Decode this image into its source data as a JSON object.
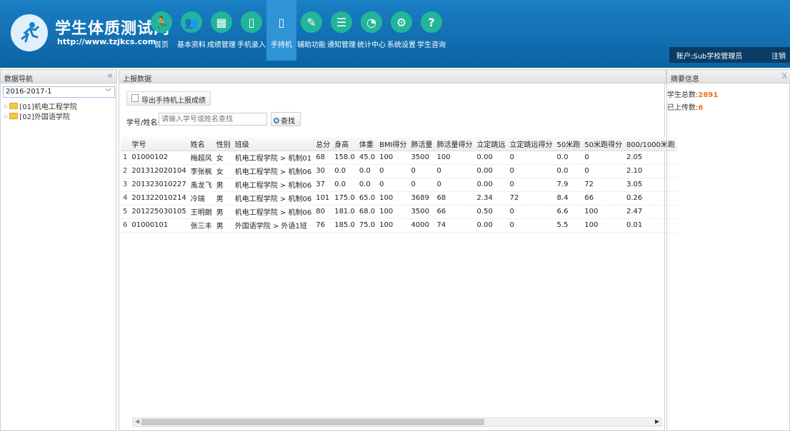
{
  "header": {
    "title": "学生体质测试网",
    "url": "http://www.tzjkcs.com",
    "nav": [
      {
        "label": "首页",
        "icon": "runner-icon",
        "glyph": "🏃"
      },
      {
        "label": "基本资料",
        "icon": "people-icon",
        "glyph": "👥"
      },
      {
        "label": "成绩管理",
        "icon": "chart-icon",
        "glyph": "▦"
      },
      {
        "label": "手机录入",
        "icon": "phone-icon",
        "glyph": "▯"
      },
      {
        "label": "手持机",
        "icon": "handheld-icon",
        "glyph": "▯"
      },
      {
        "label": "辅助功能",
        "icon": "tools-icon",
        "glyph": "✎"
      },
      {
        "label": "通知管理",
        "icon": "message-icon",
        "glyph": "☰"
      },
      {
        "label": "统计中心",
        "icon": "pie-icon",
        "glyph": "◔"
      },
      {
        "label": "系统设置",
        "icon": "sliders-icon",
        "glyph": "⚙"
      },
      {
        "label": "学生咨询",
        "icon": "question-icon",
        "glyph": "?"
      }
    ],
    "account": "账户:Sub学校管理员",
    "logout": "注销"
  },
  "left": {
    "title": "数据导航",
    "collapse": "«",
    "year": "2016-2017-1",
    "tree": [
      "[01]机电工程学院",
      "[02]外国语学院"
    ]
  },
  "main": {
    "title": "上报数据",
    "export_label": "导出手持机上报成绩",
    "search_label": "学号/姓名:",
    "search_placeholder": "请输入学号或姓名查找",
    "search_button": "查找",
    "columns": [
      "",
      "学号",
      "姓名",
      "性别",
      "班级",
      "总分",
      "身高",
      "体重",
      "BMI得分",
      "肺活量",
      "肺活量得分",
      "立定跳远",
      "立定跳远得分",
      "50米跑",
      "50米跑得分",
      "800/1000米跑"
    ],
    "rows": [
      [
        "1",
        "01000102",
        "梅超风",
        "女",
        "机电工程学院 > 机制01",
        "68",
        "158.0",
        "45.0",
        "100",
        "3500",
        "100",
        "0.00",
        "0",
        "0.0",
        "0",
        "2.05"
      ],
      [
        "2",
        "201312020104",
        "李张枫",
        "女",
        "机电工程学院 > 机制06",
        "30",
        "0.0",
        "0.0",
        "0",
        "0",
        "0",
        "0.00",
        "0",
        "0.0",
        "0",
        "2.10"
      ],
      [
        "3",
        "201323010227",
        "禹龙飞",
        "男",
        "机电工程学院 > 机制06",
        "37",
        "0.0",
        "0.0",
        "0",
        "0",
        "0",
        "0.00",
        "0",
        "7.9",
        "72",
        "3.05"
      ],
      [
        "4",
        "201322010214",
        "冷瑞",
        "男",
        "机电工程学院 > 机制06",
        "101",
        "175.0",
        "65.0",
        "100",
        "3689",
        "68",
        "2.34",
        "72",
        "8.4",
        "66",
        "0.26"
      ],
      [
        "5",
        "201225030105",
        "王明朗",
        "男",
        "机电工程学院 > 机制06",
        "80",
        "181.0",
        "68.0",
        "100",
        "3500",
        "66",
        "0.50",
        "0",
        "6.6",
        "100",
        "2.47"
      ],
      [
        "6",
        "01000101",
        "张三丰",
        "男",
        "外国语学院 > 外语1班",
        "76",
        "185.0",
        "75.0",
        "100",
        "4000",
        "74",
        "0.00",
        "0",
        "5.5",
        "100",
        "0.01"
      ]
    ]
  },
  "right": {
    "title": "摘要信息",
    "close": "X",
    "total_label": "学生总数:",
    "total_value": "2891",
    "uploaded_label": "已上传数:",
    "uploaded_value": "6"
  },
  "colors": {
    "header": "#1a7fc4",
    "accent": "#23b59b",
    "highlight": "#f0711c"
  }
}
